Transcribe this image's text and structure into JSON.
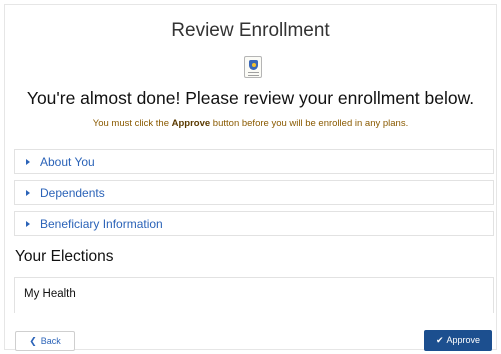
{
  "page": {
    "title": "Review Enrollment",
    "headline": "You're almost done! Please review your enrollment below.",
    "notice_prefix": "You must click the ",
    "notice_bold": "Approve",
    "notice_suffix": " button before you will be enrolled in any plans."
  },
  "accordions": [
    {
      "label": "About You"
    },
    {
      "label": "Dependents"
    },
    {
      "label": "Beneficiary Information"
    }
  ],
  "elections": {
    "title": "Your Elections",
    "items": [
      {
        "label": "My Health"
      }
    ]
  },
  "footer": {
    "back_label": "Back",
    "approve_label": "Approve"
  },
  "icons": {
    "document": "document-shield-icon",
    "accordion": "caret-right-icon",
    "back": "chevron-left-icon",
    "approve": "check-icon"
  },
  "colors": {
    "link_blue": "#2b63b8",
    "primary_button": "#1c4f8f",
    "notice_text": "#8a5a00"
  }
}
